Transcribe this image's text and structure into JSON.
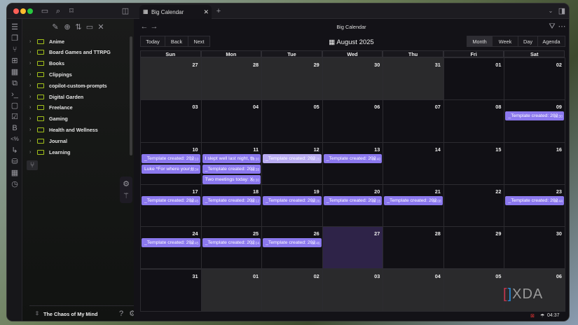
{
  "tab": {
    "title": "Big Calendar"
  },
  "view": {
    "title": "Big Calendar",
    "month_label": "August 2025"
  },
  "toolbar": {
    "today": "Today",
    "back": "Back",
    "next": "Next",
    "views": [
      "Month",
      "Week",
      "Day",
      "Agenda"
    ],
    "active_view": "Month"
  },
  "weekdays": [
    "Sun",
    "Mon",
    "Tue",
    "Wed",
    "Thu",
    "Fri",
    "Sat"
  ],
  "sidebar": {
    "folders": [
      "Anime",
      "Board Games and TTRPG",
      "Books",
      "Clippings",
      "copilot-custom-prompts",
      "Digital Garden",
      "Freelance",
      "Gaming",
      "Health and Wellness",
      "Journal",
      "Learning"
    ],
    "vault": "The Chaos of My Mind"
  },
  "weeks": [
    [
      {
        "d": "27",
        "out": true
      },
      {
        "d": "28",
        "out": true
      },
      {
        "d": "29",
        "out": true
      },
      {
        "d": "30",
        "out": true
      },
      {
        "d": "31",
        "out": true
      },
      {
        "d": "01"
      },
      {
        "d": "02"
      }
    ],
    [
      {
        "d": "03"
      },
      {
        "d": "04"
      },
      {
        "d": "05"
      },
      {
        "d": "06"
      },
      {
        "d": "07"
      },
      {
        "d": "08"
      },
      {
        "d": "09",
        "events": [
          {
            "label": "_Template created: 202",
            "time": "23:30"
          }
        ]
      }
    ],
    [
      {
        "d": "10",
        "events": [
          {
            "label": "_Template created: 202",
            "time": "10:10"
          },
          {
            "label": "Luke *For where your tr",
            "time": "13:34"
          }
        ]
      },
      {
        "d": "11",
        "events": [
          {
            "label": "I slept well last night, th",
            "time": "08:30"
          },
          {
            "label": "_Template created: 202",
            "time": "08:38"
          },
          {
            "label": "Two meetings today: X",
            "time": "08:30"
          }
        ]
      },
      {
        "d": "12",
        "events": [
          {
            "label": "_Template created: 202",
            "time": "08:26",
            "selected": true
          }
        ]
      },
      {
        "d": "13",
        "events": [
          {
            "label": "_Template created: 202",
            "time": "08:40"
          }
        ]
      },
      {
        "d": "14"
      },
      {
        "d": "15"
      },
      {
        "d": "16"
      }
    ],
    [
      {
        "d": "17",
        "events": [
          {
            "label": "_Template created: 202",
            "time": "08:45"
          }
        ]
      },
      {
        "d": "18",
        "events": [
          {
            "label": "_Template created: 202",
            "time": "08:12"
          }
        ]
      },
      {
        "d": "19",
        "events": [
          {
            "label": "_Template created: 202",
            "time": "08:26"
          }
        ]
      },
      {
        "d": "20",
        "events": [
          {
            "label": "_Template created: 202",
            "time": "08:15"
          }
        ]
      },
      {
        "d": "21",
        "events": [
          {
            "label": "_Template created: 202",
            "time": "08:08"
          }
        ]
      },
      {
        "d": "22"
      },
      {
        "d": "23",
        "events": [
          {
            "label": "_Template created: 202",
            "time": "08:44"
          }
        ]
      }
    ],
    [
      {
        "d": "24",
        "events": [
          {
            "label": "_Template created: 202",
            "time": "08:45"
          }
        ]
      },
      {
        "d": "25",
        "events": [
          {
            "label": "_Template created: 202",
            "time": "21:04"
          }
        ]
      },
      {
        "d": "26",
        "events": [
          {
            "label": "_Template created: 202",
            "time": "08:46"
          }
        ]
      },
      {
        "d": "27",
        "today": true
      },
      {
        "d": "28"
      },
      {
        "d": "29"
      },
      {
        "d": "30"
      }
    ],
    [
      {
        "d": "31"
      },
      {
        "d": "01",
        "out": true
      },
      {
        "d": "02",
        "out": true
      },
      {
        "d": "03",
        "out": true
      },
      {
        "d": "04",
        "out": true
      },
      {
        "d": "05",
        "out": true
      },
      {
        "d": "06",
        "out": true
      }
    ]
  ],
  "watermark": "XDA",
  "status": {
    "time": "04:37"
  },
  "colors": {
    "event": "#8b78ee",
    "today": "#2e2348",
    "folder": "#a3c21a"
  }
}
